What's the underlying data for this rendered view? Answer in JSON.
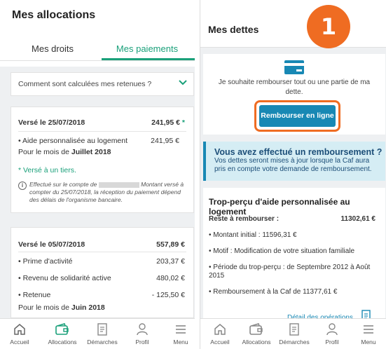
{
  "left": {
    "title": "Mes allocations",
    "tabs": [
      {
        "label": "Mes droits"
      },
      {
        "label": "Mes paiements"
      }
    ],
    "accordion_label": "Comment sont calculées mes retenues ?",
    "payment1": {
      "header_label": "Versé le 25/07/2018",
      "header_amount": "241,95 €",
      "header_star": "*",
      "line1_label": "• Aide personnalisée au logement",
      "line1_amount": "241,95 €",
      "month_prefix": "Pour le mois de ",
      "month_value": "Juillet 2018",
      "tiers_note": "* Versé à un tiers.",
      "info_icon": "info-icon",
      "info_text_a": "Effectué sur le compte de ",
      "info_text_b": " Montant versé à compter du 25/07/2018, la réception du paiement dépend des délais de l'organisme bancaire."
    },
    "payment2": {
      "header_label": "Versé le 05/07/2018",
      "header_amount": "557,89 €",
      "lines": [
        {
          "label": "• Prime d'activité",
          "amount": "203,37 €"
        },
        {
          "label": "• Revenu de solidarité active",
          "amount": "480,02 €"
        },
        {
          "label": "• Retenue",
          "amount": "- 125,50 €"
        }
      ],
      "month_prefix": "Pour le mois de ",
      "month_value": "Juin 2018"
    }
  },
  "right": {
    "title": "Mes dettes",
    "step_badge": "1",
    "refund_icon": "credit-card-icon",
    "refund_text": "Je souhaite rembourser tout ou une partie de ma dette.",
    "refund_button": "Rembourser en ligne",
    "notice_title": "Vous avez effectué un remboursement ?",
    "notice_body": "Vos dettes seront mises à jour lorsque la Caf aura pris en compte votre demande de remboursement.",
    "trop_title": "Trop-perçu d'aide personnalisée au logement",
    "reste_label": "Reste à rembourser :",
    "reste_value": "11302,61 €",
    "details": [
      "• Montant initial : 11596,31 €",
      "• Motif : Modification de votre situation familiale",
      "• Période du trop-perçu : de Septembre 2012 à Août 2015",
      "• Remboursement à la Caf de 11377,61 €"
    ],
    "detail_link": "Détail des opérations"
  },
  "nav": [
    {
      "label": "Accueil",
      "icon": "home-icon"
    },
    {
      "label": "Allocations",
      "icon": "wallet-icon"
    },
    {
      "label": "Démarches",
      "icon": "document-icon"
    },
    {
      "label": "Profil",
      "icon": "user-icon"
    },
    {
      "label": "Menu",
      "icon": "hamburger-icon"
    }
  ],
  "colors": {
    "accent_green": "#1aa07a",
    "primary_blue": "#1888b4",
    "highlight_orange": "#ef6c22",
    "notice_bg": "#d5edf4"
  }
}
